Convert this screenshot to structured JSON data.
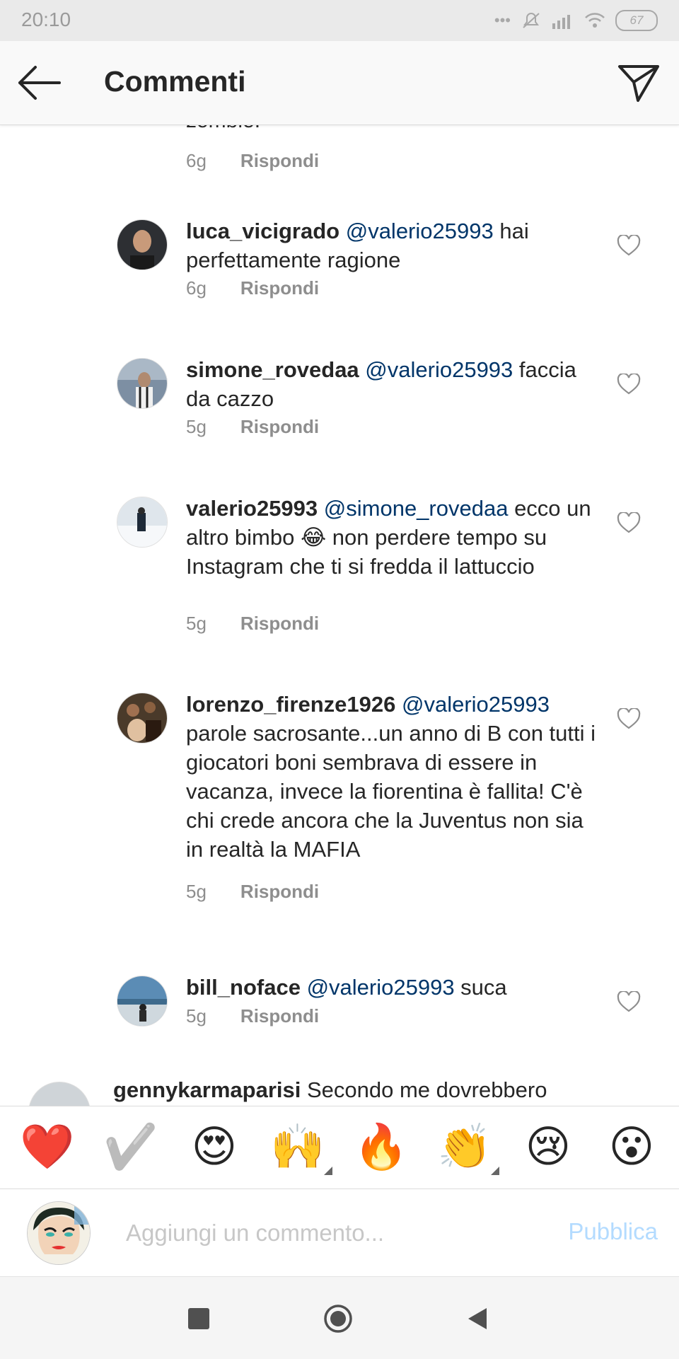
{
  "status_bar": {
    "time": "20:10",
    "battery": "67",
    "dots": "•••"
  },
  "header": {
    "title": "Commenti"
  },
  "partial_comment": {
    "text_tail": "zombie.",
    "time": "6g",
    "reply": "Rispondi"
  },
  "comments": [
    {
      "user": "luca_vicigrado",
      "mention": "@valerio25993",
      "text": " hai perfettamente ragione",
      "time": "6g",
      "reply": "Rispondi",
      "avatar_color": "#2d2f33"
    },
    {
      "user": "simone_rovedaa",
      "mention": "@valerio25993",
      "text": " faccia da cazzo",
      "time": "5g",
      "reply": "Rispondi",
      "avatar_color": "#7d8fa3"
    },
    {
      "user": "valerio25993",
      "mention": "@simone_rovedaa",
      "text": " ecco un altro bimbo 😂 non perdere tempo su Instagram che ti si fredda il lattuccio",
      "time": "5g",
      "reply": "Rispondi",
      "avatar_color": "#c9d2db"
    },
    {
      "user": "lorenzo_firenze1926",
      "mention": "@valerio25993",
      "text": " parole sacrosante...un anno di B con tutti i giocatori boni sembrava di essere in vacanza, invece la fiorentina è fallita! C'è chi crede ancora che la Juventus non sia in realtà la MAFIA",
      "time": "5g",
      "reply": "Rispondi",
      "avatar_color": "#4a3a2a"
    },
    {
      "user": "bill_noface",
      "mention": "@valerio25993",
      "text": " suca",
      "time": "5g",
      "reply": "Rispondi",
      "avatar_color": "#5b8cb5"
    }
  ],
  "cut_comment": {
    "user": "gennykarmaparisi",
    "text": " Secondo me dovrebbero"
  },
  "emoji_bar": [
    "❤️",
    "✔️",
    "😍",
    "🙌",
    "🔥",
    "👏",
    "😢",
    "😮"
  ],
  "composer": {
    "placeholder": "Aggiungi un commento...",
    "publish_label": "Pubblica"
  },
  "colors": {
    "mention": "#003569",
    "meta": "#8e8e8e",
    "publish_disabled": "#b3dbff"
  }
}
